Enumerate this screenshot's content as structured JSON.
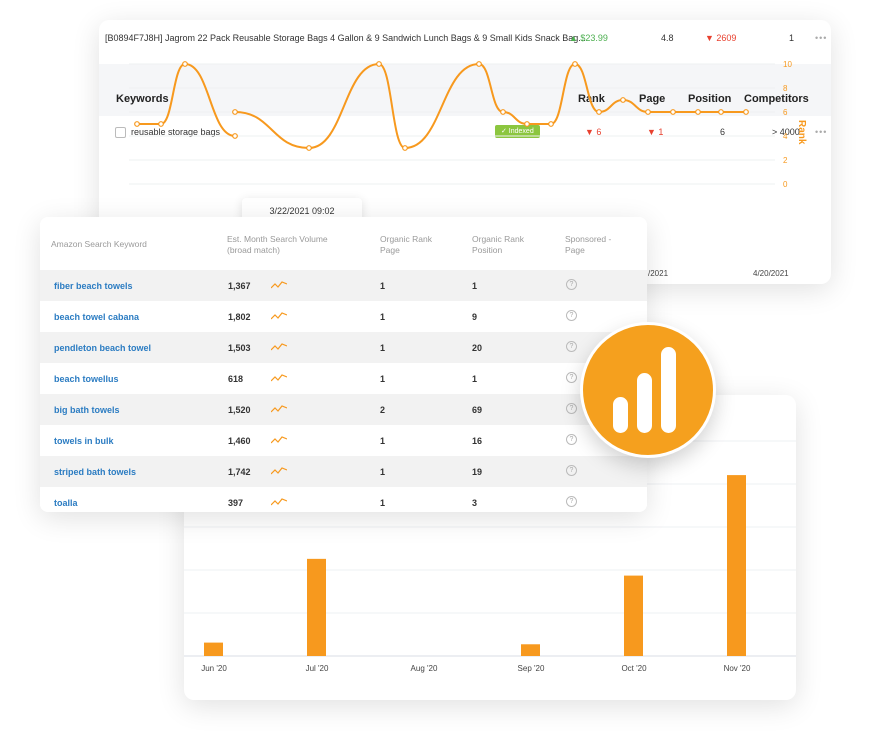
{
  "product": {
    "title": "[B0894F7J8H] Jagrom 22 Pack Reusable Storage Bags 4 Gallon & 9 Sandwich Lunch Bags & 9 Small Kids Snack Bag...",
    "price": "▲ $23.99",
    "rating": "4.8",
    "rank": "▼ 2609",
    "count": "1",
    "more": "•••"
  },
  "keywords_table": {
    "headers": {
      "keywords": "Keywords",
      "rank": "Rank",
      "page": "Page",
      "position": "Position",
      "competitors": "Competitors"
    },
    "row": {
      "keyword": "reusable storage bags",
      "status": "✓ Indexed",
      "rank": "▼ 6",
      "page": "▼ 1",
      "position": "6",
      "competitors": "> 4000",
      "more": "•••"
    }
  },
  "rank_chart": {
    "tooltip": "3/22/2021 09:02",
    "ylabel": "Rank",
    "x_labels": [
      "/2021",
      "4/20/2021"
    ],
    "colors": {
      "line": "#f7991e",
      "axis_text": "#f7991e"
    }
  },
  "chart_data": [
    {
      "type": "line",
      "ylabel": "Rank",
      "ylim": [
        0,
        10
      ],
      "y_ticks": [
        0,
        2,
        4,
        6,
        8,
        10
      ],
      "grid": true,
      "legend": "none",
      "x_labels": [
        "/2021",
        "4/20/2021"
      ],
      "series": [
        {
          "values": [
            5,
            5,
            10,
            4
          ]
        },
        {
          "values": [
            6,
            3,
            10,
            3,
            10,
            6,
            5,
            5,
            10,
            6,
            7,
            6,
            6,
            6,
            6,
            6,
            6
          ]
        }
      ]
    },
    {
      "type": "bar",
      "categories": [
        "Jun '20",
        "Jul '20",
        "Aug '20",
        "Sep '20",
        "Oct '20",
        "Nov '20"
      ],
      "values": [
        8,
        58,
        0,
        7,
        48,
        108
      ],
      "ylim": [
        0,
        120
      ],
      "grid": true,
      "colors": {
        "bar": "#f7991e"
      }
    }
  ],
  "search_table": {
    "headers": {
      "keyword": "Amazon Search Keyword",
      "volume": "Est. Month Search Volume (broad match)",
      "organic_page": "Organic Rank Page",
      "organic_position": "Organic Rank Position",
      "sponsored": "Sponsored - Page"
    },
    "rows": [
      {
        "keyword": "fiber beach towels",
        "volume": "1,367",
        "page": "1",
        "position": "1"
      },
      {
        "keyword": "beach towel cabana",
        "volume": "1,802",
        "page": "1",
        "position": "9"
      },
      {
        "keyword": "pendleton beach towel",
        "volume": "1,503",
        "page": "1",
        "position": "20"
      },
      {
        "keyword": "beach towellus",
        "volume": "618",
        "page": "1",
        "position": "1"
      },
      {
        "keyword": "big bath towels",
        "volume": "1,520",
        "page": "2",
        "position": "69"
      },
      {
        "keyword": "towels in bulk",
        "volume": "1,460",
        "page": "1",
        "position": "16"
      },
      {
        "keyword": "striped bath towels",
        "volume": "1,742",
        "page": "1",
        "position": "19"
      },
      {
        "keyword": "toalla",
        "volume": "397",
        "page": "1",
        "position": "3"
      }
    ],
    "help_glyph": "?"
  },
  "colors": {
    "accent": "#f7991e",
    "link": "#2b7cc2",
    "badge": "#f5a01e",
    "indexed": "#8cc63f",
    "down": "#e8412f",
    "up": "#4caf50"
  }
}
